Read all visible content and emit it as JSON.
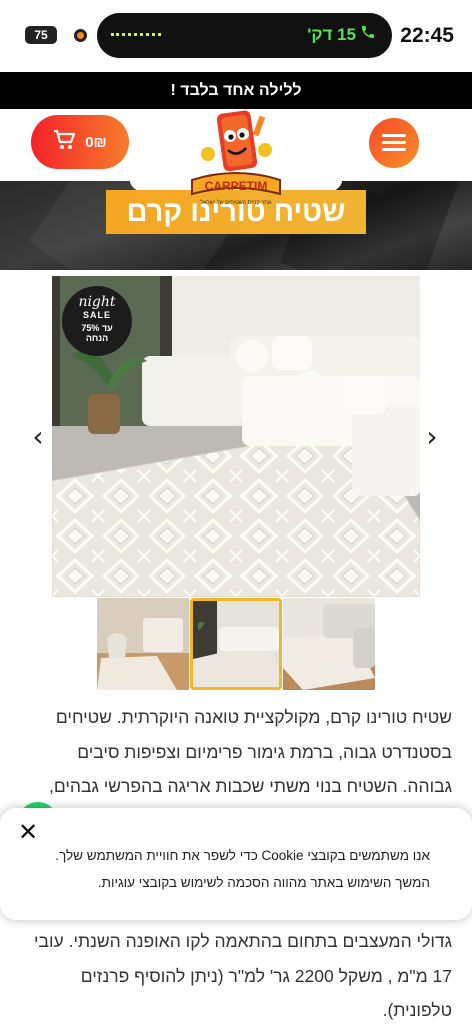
{
  "status_bar": {
    "time": "22:45",
    "call_label": "15 דק'",
    "battery": "75",
    "icons": [
      "phone-icon",
      "recording-icon",
      "battery-icon"
    ]
  },
  "promo": {
    "text": "ללילה אחד בלבד !"
  },
  "header": {
    "cart_amount": "0₪",
    "logo_text": "CARPETIM",
    "logo_tagline": "אתר קניית השטיחים של ישראל"
  },
  "hero": {
    "title": "שטיח טורינו קרם"
  },
  "gallery": {
    "sale_badge": {
      "script": "night",
      "word": "SALE",
      "percent": "עד 75%",
      "sub": "הנחה"
    },
    "prev_arrow": "‹",
    "next_arrow": "›",
    "thumbnail_count": 3,
    "active_thumbnail": 2
  },
  "description": {
    "lines": [
      "שטיח טורינו קרם, מקולקציית טואנה היוקרתית. שטיחים",
      "בסטנדרט גבוה, ברמת גימור פרימיום וצפיפות סיבים",
      "גבוהה. השטיח בנוי משתי שכבות אריגה בהפרשי גבהים,"
    ],
    "lines_after": [
      "גדולי המעצבים בתחום בהתאמה לקו האופנה השנתי. עובי",
      "17 מ\"מ , משקל 2200 גר' למ\"ר (ניתן להוסיף פרנזים",
      "טלפונית)."
    ]
  },
  "cookie_banner": {
    "close": "✕",
    "line1": "אנו משתמשים בקובצי Cookie כדי לשפר את חוויית המשתמש שלך.",
    "line2": "המשך השימוש באתר מהווה הסכמה לשימוש בקובצי עוגיות."
  },
  "colors": {
    "accent_red": "#f3222a",
    "accent_orange": "#f77d2a",
    "hero_label": "#f5a623",
    "thumb_active": "#f5b52a"
  }
}
